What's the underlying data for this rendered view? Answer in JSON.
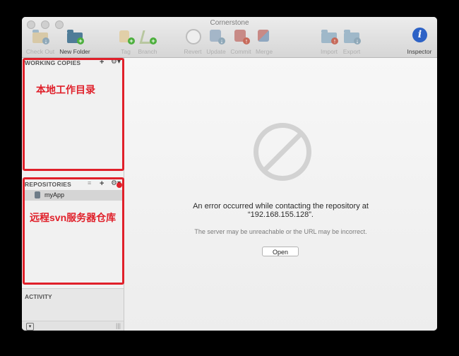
{
  "window": {
    "title": "Cornerstone"
  },
  "toolbar": {
    "check_out": "Check Out",
    "new_folder": "New Folder",
    "tag": "Tag",
    "branch": "Branch",
    "revert": "Revert",
    "update": "Update",
    "commit": "Commit",
    "merge": "Merge",
    "import": "Import",
    "export": "Export",
    "inspector": "Inspector"
  },
  "sidebar": {
    "working_copies": {
      "title": "WORKING COPIES",
      "annotation": "本地工作目录"
    },
    "repositories": {
      "title": "REPOSITORIES",
      "items": [
        {
          "name": "myApp"
        }
      ],
      "annotation": "远程svn服务器仓库"
    },
    "activity": {
      "title": "ACTIVITY"
    }
  },
  "main": {
    "error_line1": "An error occurred while contacting the repository at",
    "error_line2": "“192.168.155.128”.",
    "sub_message": "The server may be unreachable or the URL may be incorrect.",
    "open_button": "Open"
  },
  "colors": {
    "annotation_red": "#e0202a",
    "accent_blue": "#2d62c6"
  }
}
